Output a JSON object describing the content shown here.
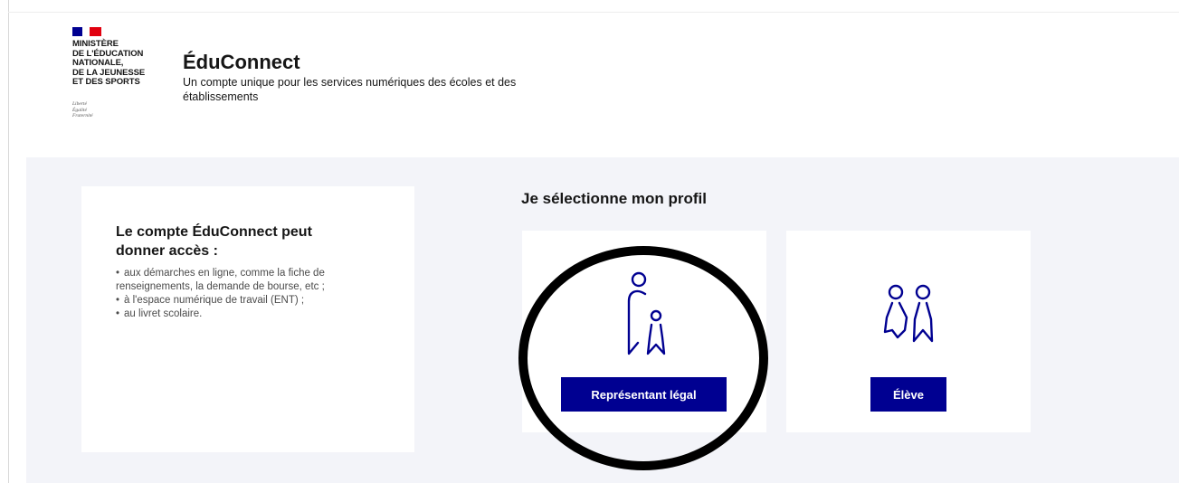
{
  "header": {
    "ministry": "MINISTÈRE\nDE L'ÉDUCATION\nNATIONALE,\nDE LA JEUNESSE\nET DES SPORTS",
    "motto": "Liberté\nÉgalité\nFraternité",
    "title": "ÉduConnect",
    "subtitle": "Un compte unique pour les services numériques des écoles et des établissements",
    "flag_colors": [
      "#000091",
      "#ffffff",
      "#e1000f"
    ]
  },
  "info": {
    "title": "Le compte ÉduConnect peut donner accès :",
    "items": [
      "aux démarches en ligne, comme la fiche de renseignements, la demande de bourse, etc ;",
      "à l'espace numérique de travail (ENT) ;",
      "au livret scolaire."
    ]
  },
  "profiles": {
    "heading": "Je sélectionne mon profil",
    "legal": {
      "label": "Représentant légal",
      "icon": "parent-child-icon"
    },
    "eleve": {
      "label": "Élève",
      "icon": "students-icon"
    }
  },
  "colors": {
    "primary": "#000091",
    "background": "#f3f4f9",
    "text": "#161616"
  }
}
